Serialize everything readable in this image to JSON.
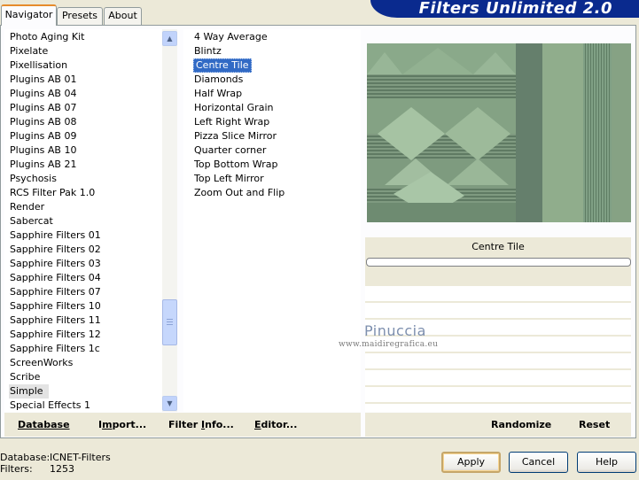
{
  "tabs": [
    "Navigator",
    "Presets",
    "About"
  ],
  "banner_title": "Filters Unlimited 2.0",
  "categories": [
    "Photo Aging Kit",
    "Pixelate",
    "Pixellisation",
    "Plugins AB 01",
    "Plugins AB 04",
    "Plugins AB 07",
    "Plugins AB 08",
    "Plugins AB 09",
    "Plugins AB 10",
    "Plugins AB 21",
    "Psychosis",
    "RCS Filter Pak 1.0",
    "Render",
    "Sabercat",
    "Sapphire Filters 01",
    "Sapphire Filters 02",
    "Sapphire Filters 03",
    "Sapphire Filters 04",
    "Sapphire Filters 07",
    "Sapphire Filters 10",
    "Sapphire Filters 11",
    "Sapphire Filters 12",
    "Sapphire Filters 1c",
    "ScreenWorks",
    "Scribe",
    "Simple",
    "Special Effects 1"
  ],
  "selected_category": "Simple",
  "filters": [
    "4 Way Average",
    "Blintz",
    "Centre Tile",
    "Diamonds",
    "Half Wrap",
    "Horizontal Grain",
    "Left Right Wrap",
    "Pizza Slice Mirror",
    "Quarter corner",
    "Top Bottom Wrap",
    "Top Left Mirror",
    "Zoom Out and Flip"
  ],
  "selected_filter": "Centre Tile",
  "toolbar": {
    "database": "Database",
    "import_pre": "I",
    "import_u": "m",
    "import_post": "port...",
    "filterinfo_pre": "Filter ",
    "filterinfo_u": "I",
    "filterinfo_post": "nfo...",
    "editor_pre": "",
    "editor_u": "E",
    "editor_post": "ditor...",
    "randomize": "Randomize",
    "reset": "Reset"
  },
  "preview_filter_name": "Centre Tile",
  "watermark": {
    "name": "Pinuccia",
    "url": "www.maidiregrafica.eu"
  },
  "footer": {
    "database_label": "Database:",
    "database_value": "ICNET-Filters",
    "filters_label": "Filters:",
    "filters_value": "1253",
    "apply": "Apply",
    "cancel": "Cancel",
    "help": "Help"
  },
  "colors": {
    "selection": "#316ac5",
    "banner": "#0a2a8e",
    "preview_green": "#8fa98a"
  },
  "icons": {
    "scroll_up": "triangle-up",
    "scroll_down": "triangle-down"
  }
}
